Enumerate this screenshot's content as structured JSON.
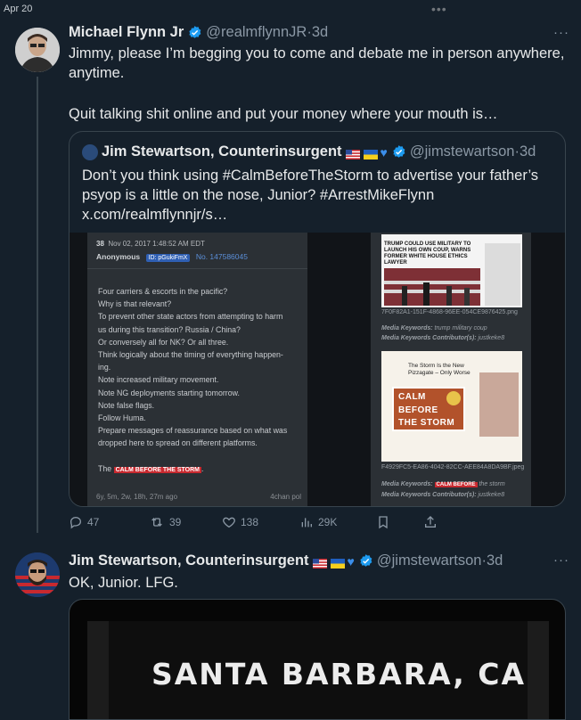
{
  "top_bar": {
    "date": "Apr 20",
    "more_icon": "more-dots-icon"
  },
  "colors": {
    "background": "#15202b",
    "text": "#e7e9ea",
    "muted": "#8b98a5",
    "verified": "#1d9bf0",
    "border": "#38444d"
  },
  "tweet1": {
    "name": "Michael Flynn Jr",
    "handle": "@realmflynnJR",
    "time": "3d",
    "text_line1": "Jimmy, please I’m begging you to come and debate me in person anywhere, anytime.",
    "text_line2": "Quit talking shit online and put your money where your mouth is…",
    "quote": {
      "name": "Jim Stewartson, Counterinsurgent",
      "handle": "@jimstewartson",
      "time": "3d",
      "text": "Don’t you think using #CalmBeforeTheStorm to advertise your father’s psyop is a little on the nose, Junior? #ArrestMikeFlynn x.com/realmflynnjr/s…",
      "image": {
        "post_meta": "Nov 02, 2017 1:48:52 AM EDT",
        "post_num": "38",
        "poster": "Anonymous",
        "poster_id": "ID: pGukiFmX",
        "post_no": "No. 147586045",
        "body_lines": [
          "Four carriers & escorts in the pacific?",
          "Why is that relevant?",
          "To prevent other state actors from attempting to harm",
          "us during this transition? Russia / China?",
          "Or conversely all for NK? Or all three.",
          "Think logically about the timing of everything happen-",
          "ing.",
          "Note increased military movement.",
          "Note NG deployments starting tomorrow.",
          "Note false flags.",
          "Follow Huma.",
          "Prepare messages of reassurance based on what was",
          "dropped here to spread on different platforms."
        ],
        "last_line_prefix": "The",
        "last_line_badge": "CALM BEFORE THE STORM",
        "last_line_suffix": ".",
        "post_age": "6y, 5m, 2w, 18h, 27m ago",
        "post_board": "4chan pol",
        "news_headline": "TRUMP COULD USE MILITARY TO LAUNCH HIS OWN COUP, WARNS FORMER WHITE HOUSE ETHICS LAWYER",
        "file1": "7F0F82A1-151F-4868-96EE-054CE9876425.png",
        "kw1_label": "Media Keywords:",
        "kw1_value": "trump military coup",
        "kc1_label": "Media Keywords Contributor(s):",
        "kc1_value": "justkeke8",
        "card2_title": "The Storm Is the New Pizzagate – Only Worse",
        "calm1": "CALM",
        "calm2": "BEFORE",
        "calm3": "THE STORM",
        "file2": "F4929FC5-EA86-4042-82CC-AEE84A8DA9BF.jpeg",
        "kw2_label": "Media Keywords:",
        "kw2_badge": "CALM BEFORE",
        "kw2_value": "the storm",
        "kc2_label": "Media Keywords Contributor(s):",
        "kc2_value": "justkeke8"
      }
    },
    "actions": {
      "replies": "47",
      "retweets": "39",
      "likes": "138",
      "views": "29K"
    }
  },
  "tweet2": {
    "name": "Jim Stewartson, Counterinsurgent",
    "handle": "@jimstewartson",
    "time": "3d",
    "text": "OK, Junior. LFG.",
    "media_text": "SANTA BARBARA, CA"
  }
}
